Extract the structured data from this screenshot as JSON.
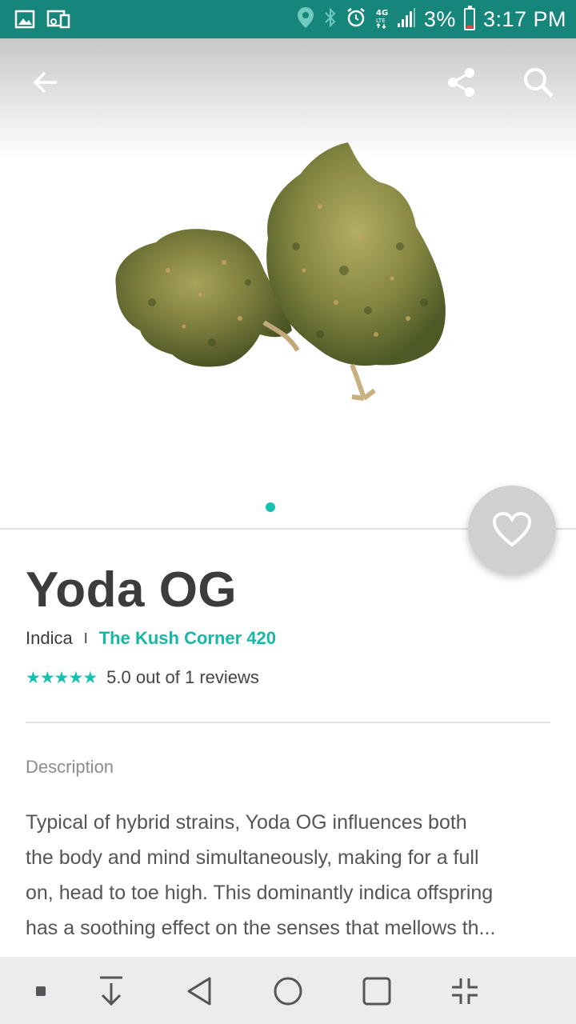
{
  "status_bar": {
    "battery": "3%",
    "time": "3:17 PM",
    "icons": [
      "image-icon",
      "cast-icon",
      "location-icon",
      "bluetooth-icon",
      "alarm-icon",
      "4g-lte-icon",
      "signal-icon",
      "battery-icon"
    ]
  },
  "toolbar": {
    "icons": [
      "back-arrow-icon",
      "share-icon",
      "search-icon"
    ]
  },
  "gallery": {
    "dots": 1,
    "active_index": 0
  },
  "product": {
    "name": "Yoda OG",
    "type": "Indica",
    "separator": "I",
    "store": "The Kush Corner 420",
    "rating_value": 5.0,
    "rating_text": "5.0 out of 1 reviews",
    "star_count": 5
  },
  "description": {
    "label": "Description",
    "lines": [
      "Typical of hybrid strains, Yoda OG influences both",
      "the body and mind simultaneously, making for a full",
      "on, head to toe high. This dominantly indica offspring",
      "has a soothing effect on the senses that mellows th..."
    ]
  },
  "colors": {
    "status_bar": "#16867a",
    "accent": "#16c1b0",
    "store_link": "#16b7a6",
    "fab": "#d0d0d0"
  },
  "nav_bar": {
    "icons": [
      "small-square-icon",
      "download-icon",
      "back-triangle-icon",
      "home-circle-icon",
      "recents-square-icon",
      "collapse-icon"
    ]
  }
}
